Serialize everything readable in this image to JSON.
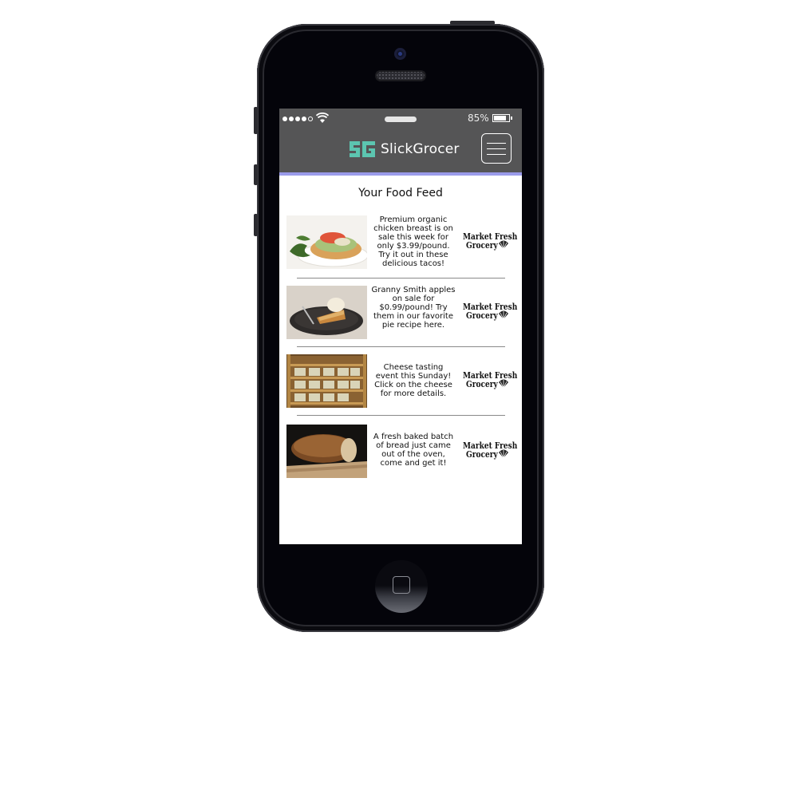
{
  "status_bar": {
    "signal_bars": 5,
    "signal_filled": 4,
    "battery_percent_label": "85%",
    "battery_level": 0.85
  },
  "app": {
    "brand_name": "SlickGrocer",
    "logo_icon": "sg-logo-icon",
    "menu_icon": "hamburger-menu-icon",
    "accent_color": "#5cc5b0",
    "header_color": "#555556",
    "underline_color": "#9a9bea"
  },
  "feed": {
    "title": "Your Food Feed",
    "items": [
      {
        "image": "chicken-taco-photo",
        "description": "Premium organic chicken breast is on sale this week for only $3.99/pound. Try it out in these delicious tacos!",
        "store_line1": "Market Fresh",
        "store_line2": "Grocery"
      },
      {
        "image": "apple-pie-photo",
        "description": "Granny Smith apples on sale for $0.99/pound! Try them in our favorite pie recipe here.",
        "store_line1": "Market Fresh",
        "store_line2": "Grocery"
      },
      {
        "image": "cheese-shelf-photo",
        "description": "Cheese tasting event this Sunday! Click on the cheese for more details.",
        "store_line1": "Market Fresh",
        "store_line2": "Grocery"
      },
      {
        "image": "bread-loaf-photo",
        "description": "A fresh baked batch of bread just came out of the oven, come and get it!",
        "store_line1": "Market Fresh",
        "store_line2": "Grocery"
      }
    ]
  }
}
